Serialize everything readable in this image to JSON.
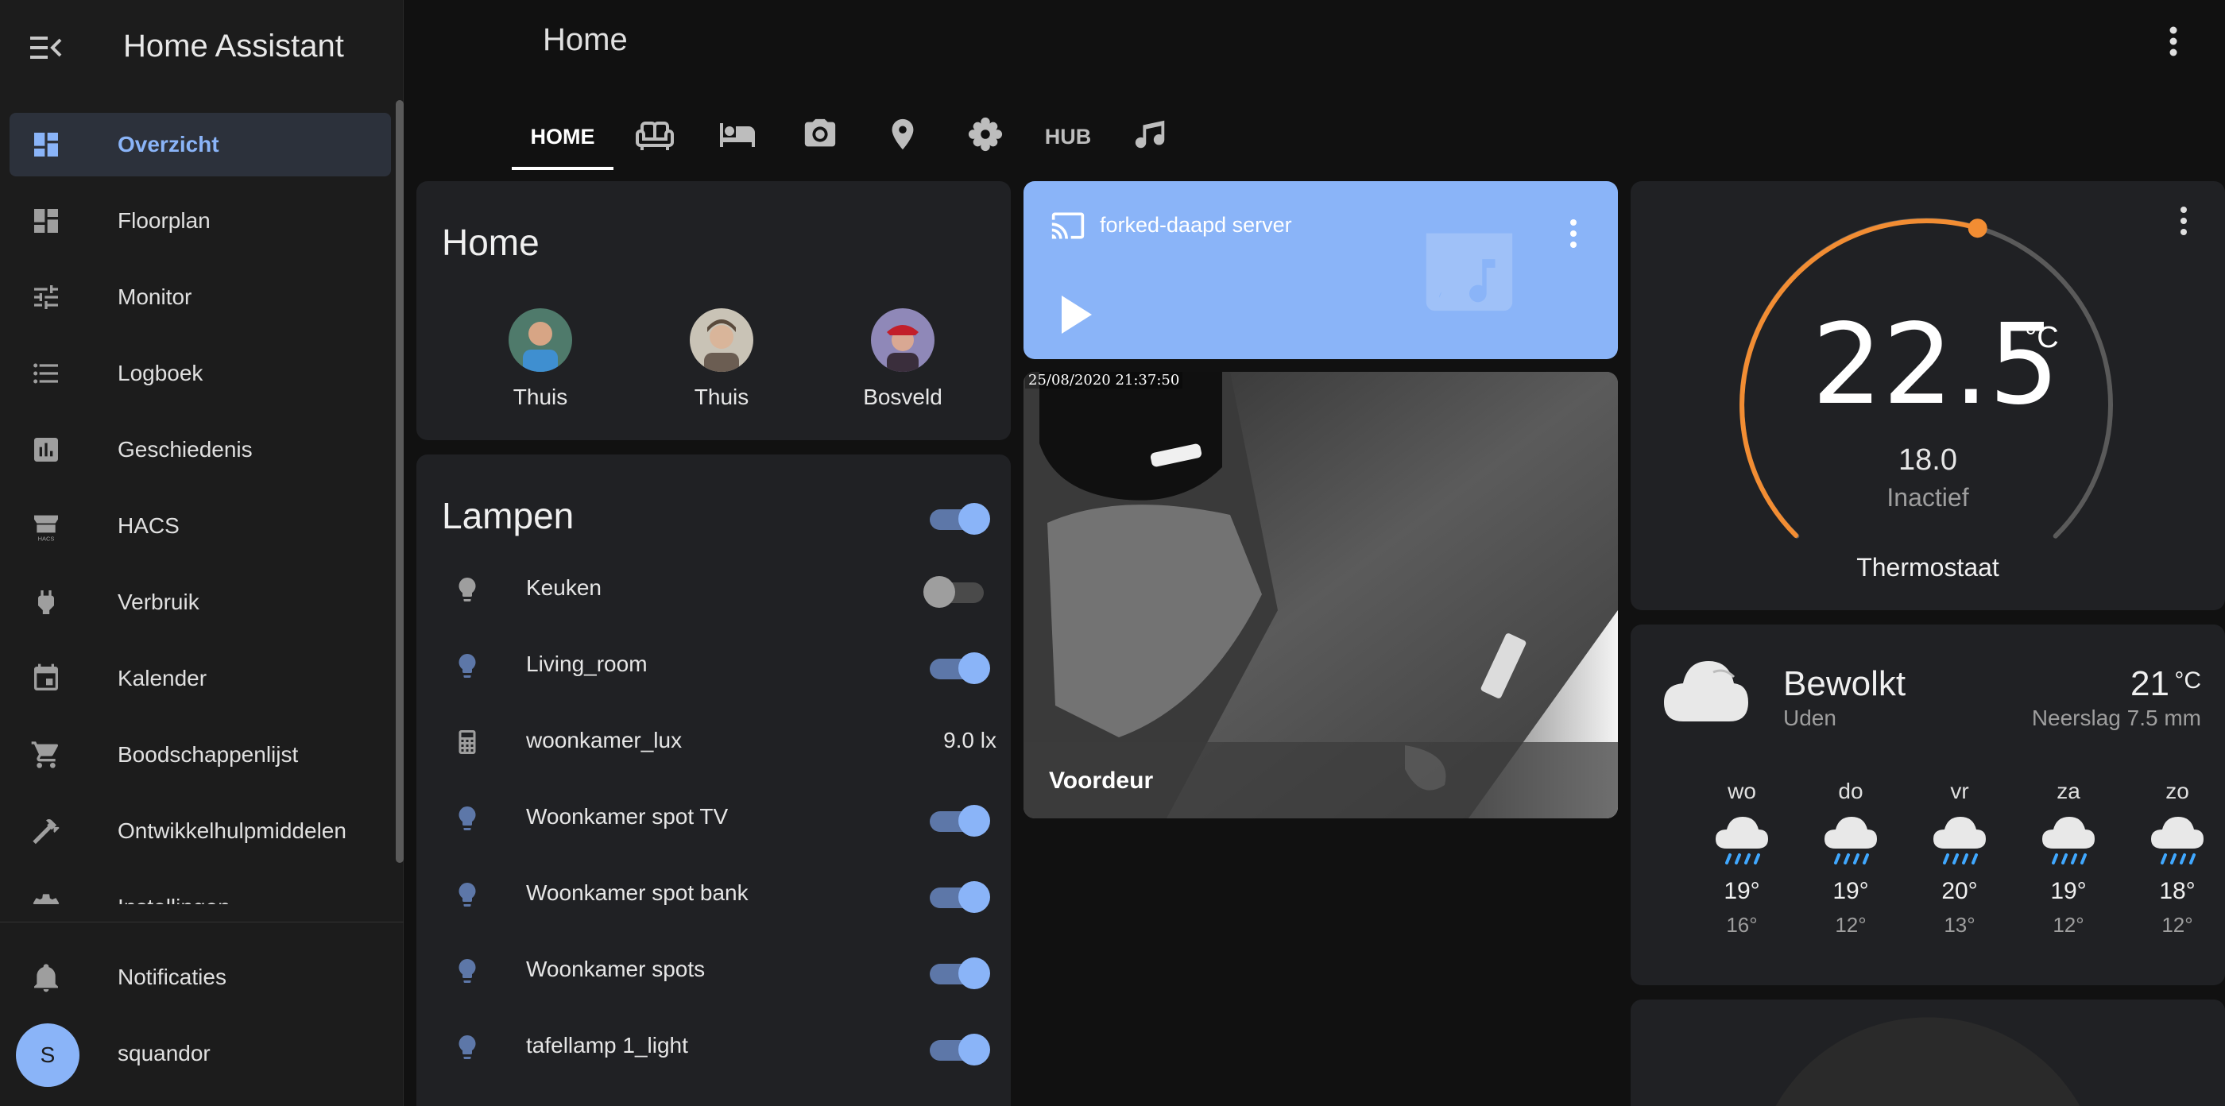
{
  "app": {
    "title": "Home Assistant"
  },
  "sidebar": {
    "items": [
      {
        "label": "Overzicht",
        "icon": "dashboard-icon"
      },
      {
        "label": "Floorplan",
        "icon": "dashboard-icon"
      },
      {
        "label": "Monitor",
        "icon": "tune-icon"
      },
      {
        "label": "Logboek",
        "icon": "list-icon"
      },
      {
        "label": "Geschiedenis",
        "icon": "chart-icon"
      },
      {
        "label": "HACS",
        "icon": "hacs-icon"
      },
      {
        "label": "Verbruik",
        "icon": "plug-icon"
      },
      {
        "label": "Kalender",
        "icon": "calendar-icon"
      },
      {
        "label": "Boodschappenlijst",
        "icon": "cart-icon"
      },
      {
        "label": "Ontwikkelhulpmiddelen",
        "icon": "hammer-icon"
      },
      {
        "label": "Instellingen",
        "icon": "gear-icon"
      }
    ],
    "notifications_label": "Notificaties",
    "user": {
      "initial": "S",
      "name": "squandor"
    }
  },
  "header": {
    "title": "Home",
    "tabs": [
      {
        "label": "HOME",
        "active": true
      },
      {
        "icon": "sofa-icon"
      },
      {
        "icon": "bed-icon"
      },
      {
        "icon": "camera-icon"
      },
      {
        "icon": "map-marker-icon"
      },
      {
        "icon": "flower-icon"
      },
      {
        "label": "HUB"
      },
      {
        "icon": "music-icon"
      }
    ]
  },
  "home_card": {
    "title": "Home",
    "persons": [
      {
        "state": "Thuis"
      },
      {
        "state": "Thuis"
      },
      {
        "state": "Bosveld"
      }
    ]
  },
  "lampen_card": {
    "title": "Lampen",
    "master_on": true,
    "rows": [
      {
        "name": "Keuken",
        "type": "toggle",
        "on": false,
        "icon": "bulb-icon"
      },
      {
        "name": "Living_room",
        "type": "toggle",
        "on": true,
        "icon": "bulb-icon"
      },
      {
        "name": "woonkamer_lux",
        "type": "value",
        "value": "9.0 lx",
        "icon": "calculator-icon"
      },
      {
        "name": "Woonkamer spot TV",
        "type": "toggle",
        "on": true,
        "icon": "bulb-icon"
      },
      {
        "name": "Woonkamer spot bank",
        "type": "toggle",
        "on": true,
        "icon": "bulb-icon"
      },
      {
        "name": "Woonkamer spots",
        "type": "toggle",
        "on": true,
        "icon": "bulb-icon"
      },
      {
        "name": "tafellamp 1_light",
        "type": "toggle",
        "on": true,
        "icon": "bulb-icon"
      }
    ]
  },
  "media": {
    "name": "forked-daapd server",
    "accent": "#8ab4f8"
  },
  "camera": {
    "name": "Voordeur",
    "timestamp": "25/08/2020 21:37:50"
  },
  "thermostat": {
    "current": "22.5",
    "unit": "°C",
    "target": "18.0",
    "status": "Inactief",
    "name": "Thermostaat",
    "arc_fraction": 0.56,
    "accent": "#f28d33"
  },
  "weather": {
    "condition": "Bewolkt",
    "location": "Uden",
    "temperature": "21",
    "unit": "°C",
    "precipitation": "Neerslag 7.5 mm",
    "forecast": [
      {
        "day": "wo",
        "high": "19°",
        "low": "16°"
      },
      {
        "day": "do",
        "high": "19°",
        "low": "12°"
      },
      {
        "day": "vr",
        "high": "20°",
        "low": "13°"
      },
      {
        "day": "za",
        "high": "19°",
        "low": "12°"
      },
      {
        "day": "zo",
        "high": "18°",
        "low": "12°"
      }
    ]
  }
}
